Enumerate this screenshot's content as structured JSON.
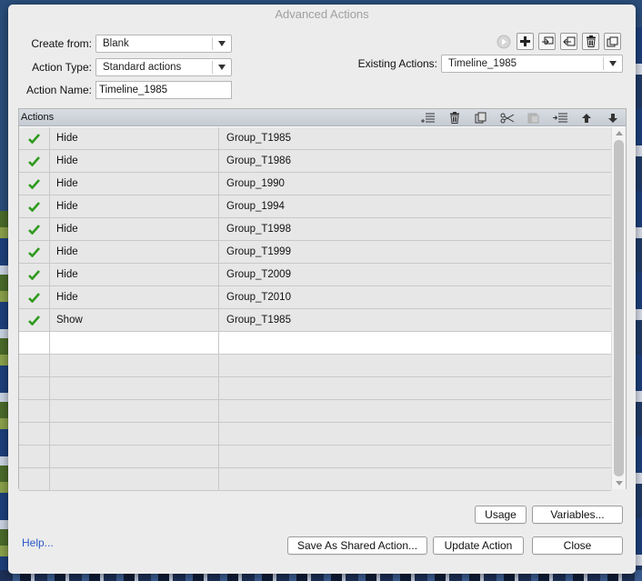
{
  "window": {
    "title": "Advanced Actions"
  },
  "form": {
    "create_from_label": "Create from:",
    "create_from_value": "Blank",
    "action_type_label": "Action Type:",
    "action_type_value": "Standard actions",
    "action_name_label": "Action Name:",
    "action_name_value": "Timeline_1985",
    "existing_actions_label": "Existing Actions:",
    "existing_actions_value": "Timeline_1985"
  },
  "top_toolbar": {
    "icons": [
      "preview-icon",
      "add-icon",
      "duplicate-icon",
      "import-icon",
      "delete-icon",
      "copy-icon"
    ]
  },
  "actions_table": {
    "header_label": "Actions",
    "tool_icons": [
      "insert-row-icon",
      "delete-row-icon",
      "copy-row-icon",
      "cut-icon",
      "paste-icon",
      "indent-icon",
      "move-up-icon",
      "move-down-icon"
    ],
    "rows": [
      {
        "checked": true,
        "action": "Hide",
        "target": "Group_T1985"
      },
      {
        "checked": true,
        "action": "Hide",
        "target": "Group_T1986"
      },
      {
        "checked": true,
        "action": "Hide",
        "target": "Group_1990"
      },
      {
        "checked": true,
        "action": "Hide",
        "target": "Group_1994"
      },
      {
        "checked": true,
        "action": "Hide",
        "target": "Group_T1998"
      },
      {
        "checked": true,
        "action": "Hide",
        "target": "Group_T1999"
      },
      {
        "checked": true,
        "action": "Hide",
        "target": "Group_T2009"
      },
      {
        "checked": true,
        "action": "Hide",
        "target": "Group_T2010"
      },
      {
        "checked": true,
        "action": "Show",
        "target": "Group_T1985"
      }
    ],
    "empty_rows": 7
  },
  "buttons": {
    "usage": "Usage",
    "variables": "Variables...",
    "save_shared": "Save As Shared Action...",
    "update_action": "Update Action",
    "close": "Close",
    "help": "Help..."
  },
  "colors": {
    "check": "#2e9b1d",
    "link": "#2a5bc7",
    "title": "#a0a0a0"
  }
}
